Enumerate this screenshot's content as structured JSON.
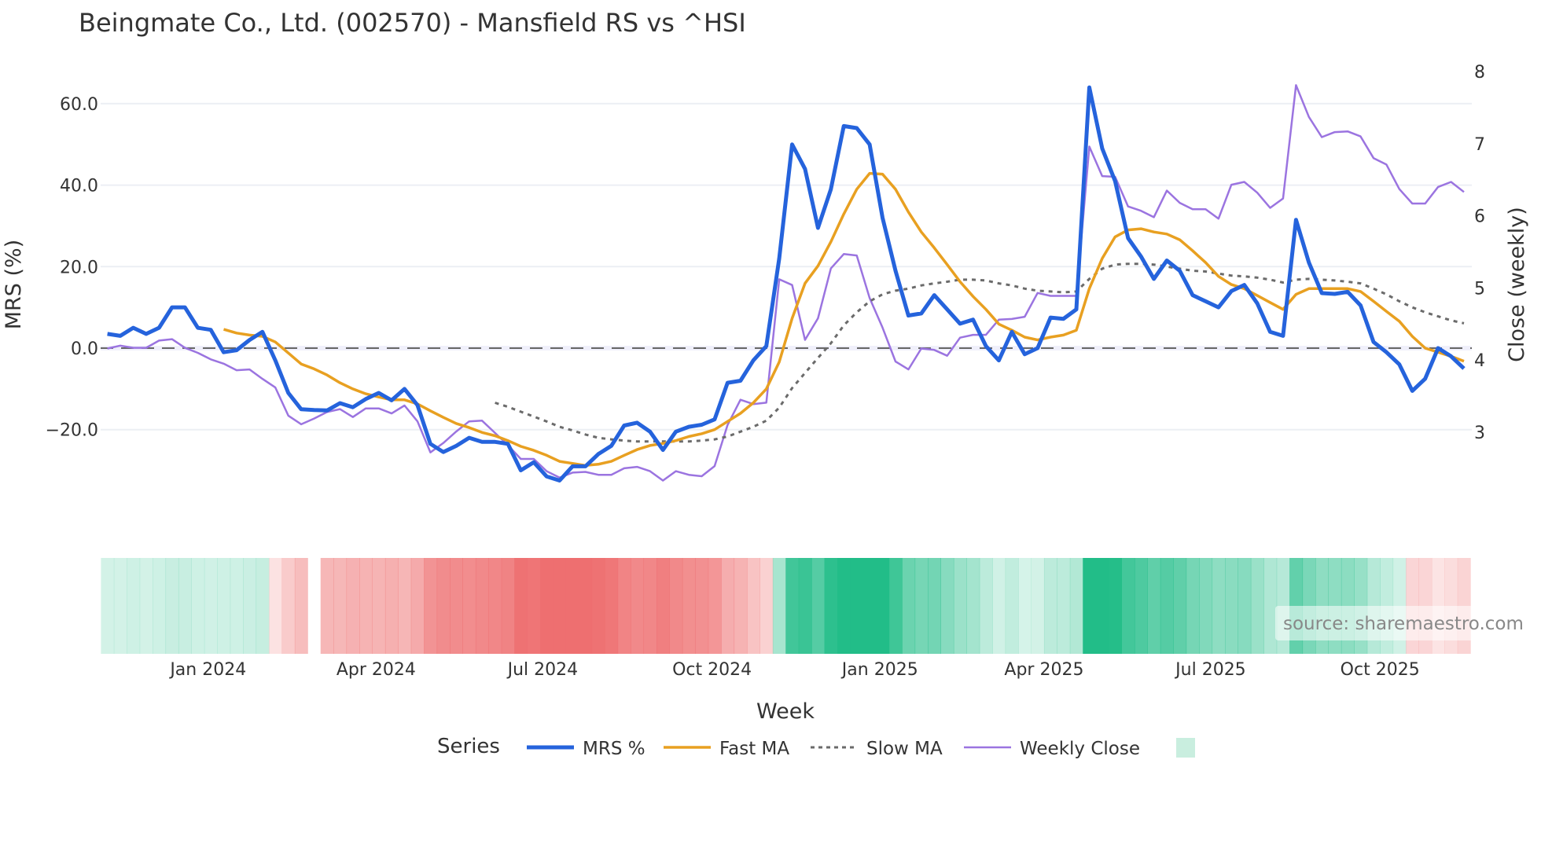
{
  "chart_data": {
    "type": "line",
    "title": "Beingmate Co., Ltd. (002570) - Mansfield RS vs ^HSI",
    "xlabel": "Week",
    "ylabel": "MRS (%)",
    "y2label": "Close (weekly)",
    "ylim": [
      -36,
      72
    ],
    "y2lim": [
      2.1,
      8.0
    ],
    "yticks": [
      60,
      40,
      20,
      0,
      -20
    ],
    "ytick_labels": [
      "60.0",
      "40.0",
      "20.0",
      "0.0",
      "−20.0"
    ],
    "y2ticks": [
      8,
      7,
      6,
      5,
      4,
      3
    ],
    "y2tick_labels": [
      "8",
      "7",
      "6",
      "5",
      "4",
      "3"
    ],
    "xtick_labels": [
      "Jan 2024",
      "Apr 2024",
      "Jul 2024",
      "Oct 2024",
      "Jan 2025",
      "Apr 2025",
      "Jul 2025",
      "Oct 2025"
    ],
    "xtick_week_index": [
      7.8,
      20.8,
      33.7,
      46.8,
      59.8,
      72.5,
      85.4,
      98.5
    ],
    "grid": true,
    "zero_line": 0,
    "legend_title": "Series",
    "legend_position": "bottom",
    "colors": {
      "mrs": "#2563dc",
      "fast": "#e8a021",
      "slow": "#6b6b6b",
      "close": "#9b74e0",
      "pos": "#22bd88",
      "neg": "#ee6f70"
    },
    "series": [
      {
        "name": "MRS %",
        "key": "mrs",
        "axis": "left",
        "values": [
          3.5,
          3,
          5,
          3.5,
          5,
          10,
          10,
          5,
          4.5,
          -1,
          -0.5,
          2,
          4,
          -3,
          -11,
          -15,
          -15.2,
          -15.3,
          -13.5,
          -14.5,
          -12.5,
          -11,
          -12.8,
          -10,
          -14,
          -23.5,
          -25.5,
          -24,
          -22,
          -23,
          -23,
          -23.5,
          -30,
          -28,
          -31.5,
          -32.5,
          -29,
          -29,
          -26,
          -24,
          -19,
          -18.3,
          -20.5,
          -25,
          -20.5,
          -19.3,
          -18.8,
          -17.5,
          -8.5,
          -8,
          -3,
          0.5,
          22,
          50,
          44,
          29.5,
          39,
          54.5,
          54,
          50,
          32,
          19,
          8,
          8.5,
          13,
          9.5,
          6,
          7,
          0.5,
          -3,
          4,
          -1.5,
          0,
          7.5,
          7.2,
          9.5,
          64,
          49,
          41,
          27,
          22.5,
          17,
          21.5,
          19,
          13,
          11.5,
          10,
          14,
          15.5,
          11,
          4,
          3,
          31.5,
          21,
          13.5,
          13.3,
          13.8,
          10.5,
          1.5,
          -1,
          -4,
          -10.5,
          -7.5,
          0,
          -2,
          -5
        ]
      },
      {
        "name": "Fast MA",
        "key": "fast",
        "axis": "left",
        "values": [
          4.6,
          3.7,
          3.2,
          2.9,
          1.5,
          -1.2,
          -3.9,
          -5.1,
          -6.6,
          -8.5,
          -10,
          -11.2,
          -12,
          -12.7,
          -12.7,
          -13.7,
          -15.4,
          -17,
          -18.5,
          -19.5,
          -20.7,
          -21.5,
          -22.7,
          -24.1,
          -25.1,
          -26.3,
          -27.8,
          -28.3,
          -28.8,
          -28.5,
          -27.8,
          -26.3,
          -24.9,
          -23.9,
          -23.4,
          -22.7,
          -21.7,
          -21,
          -20,
          -18,
          -16,
          -13.4,
          -10,
          -3.4,
          7.3,
          15.9,
          20.2,
          26.1,
          32.9,
          39,
          42.9,
          42.7,
          39,
          33.4,
          28.5,
          24.6,
          20.5,
          16.3,
          12.7,
          9.5,
          5.9,
          4.4,
          2.7,
          2,
          2.7,
          3.2,
          4.4,
          14.6,
          22,
          27.3,
          29,
          29.3,
          28.5,
          28,
          26.6,
          23.9,
          21,
          17.6,
          15.6,
          14.6,
          12.9,
          11.2,
          9.5,
          13.2,
          14.6,
          14.6,
          14.6,
          14.6,
          13.9,
          11.5,
          9,
          6.6,
          2.9,
          0,
          -1,
          -2,
          -3.2
        ]
      },
      {
        "name": "Slow MA",
        "key": "slow",
        "axis": "left",
        "values": [
          -13.4,
          -14.4,
          -15.6,
          -16.8,
          -18,
          -19.3,
          -20.2,
          -21.2,
          -22,
          -22.4,
          -22.7,
          -22.9,
          -22.9,
          -22.9,
          -22.9,
          -22.9,
          -22.7,
          -22.4,
          -21.7,
          -20.5,
          -19.3,
          -17.8,
          -14.6,
          -9.8,
          -6.1,
          -2.4,
          1.2,
          5.6,
          8.8,
          11.5,
          13.2,
          14.1,
          14.6,
          15.4,
          15.9,
          16.3,
          16.8,
          16.8,
          16.6,
          15.9,
          15.4,
          14.6,
          14.1,
          13.9,
          13.7,
          13.9,
          17,
          19.5,
          20.5,
          20.7,
          20.7,
          20.5,
          20,
          19.5,
          19,
          18.8,
          18.3,
          17.8,
          17.6,
          17.3,
          16.8,
          16.1,
          16.8,
          17,
          16.8,
          16.6,
          16.3,
          15.9,
          14.6,
          13.2,
          11.5,
          10,
          8.8,
          7.8,
          6.8,
          6.1
        ]
      },
      {
        "name": "Weekly Close",
        "key": "close",
        "axis": "right",
        "values": [
          4.16,
          4.2,
          4.17,
          4.17,
          4.27,
          4.29,
          4.17,
          4.1,
          4.01,
          3.95,
          3.86,
          3.87,
          3.74,
          3.62,
          3.23,
          3.11,
          3.19,
          3.28,
          3.32,
          3.21,
          3.33,
          3.33,
          3.26,
          3.37,
          3.15,
          2.72,
          2.85,
          3.01,
          3.15,
          3.16,
          2.99,
          2.82,
          2.63,
          2.63,
          2.46,
          2.37,
          2.44,
          2.45,
          2.41,
          2.41,
          2.5,
          2.52,
          2.46,
          2.33,
          2.46,
          2.41,
          2.39,
          2.53,
          3.1,
          3.45,
          3.39,
          3.41,
          5.12,
          5.04,
          4.28,
          4.58,
          5.27,
          5.47,
          5.45,
          4.86,
          4.45,
          3.98,
          3.87,
          4.16,
          4.14,
          4.06,
          4.31,
          4.35,
          4.35,
          4.56,
          4.57,
          4.6,
          4.93,
          4.89,
          4.89,
          4.89,
          6.96,
          6.55,
          6.54,
          6.13,
          6.07,
          5.98,
          6.35,
          6.18,
          6.09,
          6.09,
          5.96,
          6.43,
          6.47,
          6.32,
          6.11,
          6.24,
          7.81,
          7.37,
          7.09,
          7.16,
          7.17,
          7.1,
          6.8,
          6.71,
          6.37,
          6.17,
          6.17,
          6.4,
          6.47,
          6.33
        ]
      }
    ],
    "heatmap_gap_week_index": 16,
    "source": "source: sharemaestro.com"
  }
}
